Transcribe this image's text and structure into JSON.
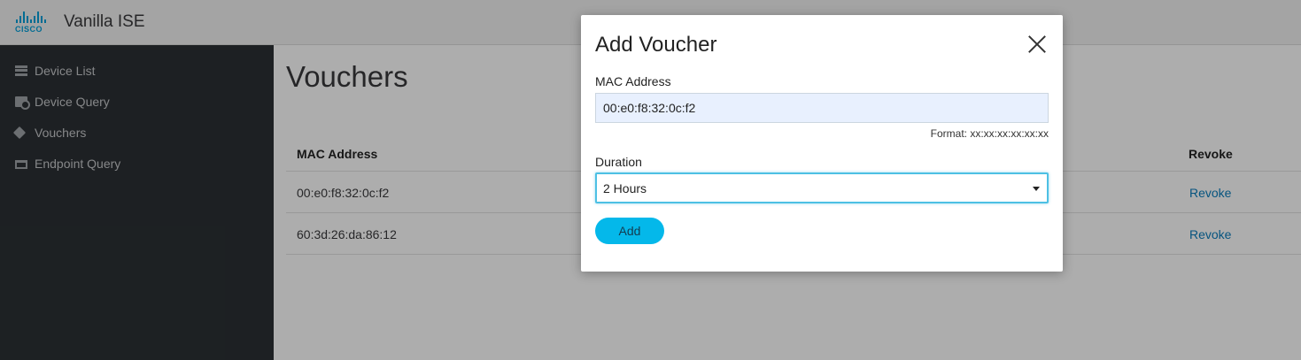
{
  "header": {
    "logo_text": "CISCO",
    "app_title": "Vanilla ISE"
  },
  "sidebar": {
    "items": [
      {
        "label": "Device List",
        "icon": "list-icon"
      },
      {
        "label": "Device Query",
        "icon": "query-icon"
      },
      {
        "label": "Vouchers",
        "icon": "tags-icon"
      },
      {
        "label": "Endpoint Query",
        "icon": "endpoint-icon"
      }
    ]
  },
  "main": {
    "page_title": "Vouchers",
    "table": {
      "columns": [
        "MAC Address",
        "Revoke"
      ],
      "rows": [
        {
          "mac": "00:e0:f8:32:0c:f2",
          "revoke": "Revoke"
        },
        {
          "mac": "60:3d:26:da:86:12",
          "revoke": "Revoke"
        }
      ]
    }
  },
  "modal": {
    "title": "Add Voucher",
    "mac_label": "MAC Address",
    "mac_value": "00:e0:f8:32:0c:f2",
    "mac_hint": "Format: xx:xx:xx:xx:xx:xx",
    "duration_label": "Duration",
    "duration_value": "2 Hours",
    "add_label": "Add"
  },
  "colors": {
    "brand": "#049fd9",
    "sidebar_bg": "#2b3034",
    "accent_button": "#04b8ea",
    "link": "#097dbc"
  }
}
